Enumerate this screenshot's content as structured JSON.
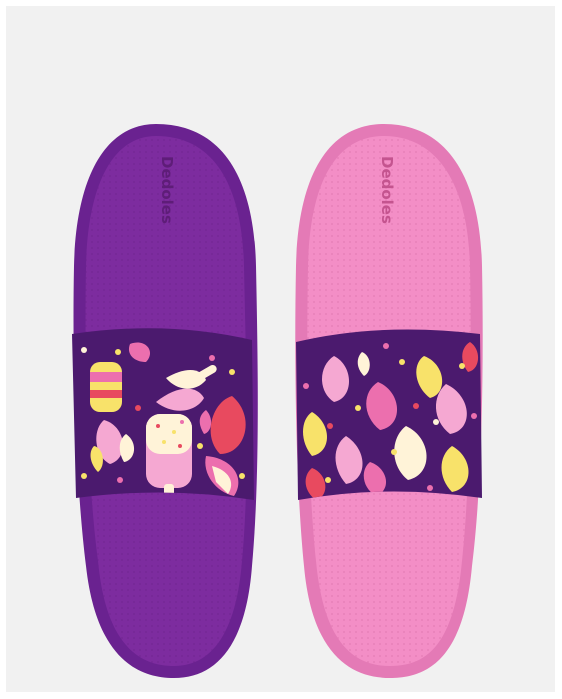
{
  "product": {
    "brand_logo_left": "Dedoles",
    "brand_logo_right": "Dedoles"
  },
  "colors": {
    "background": "#f1f1f1",
    "left_sole": "#7a2a9a",
    "left_sole_dark": "#5e1d78",
    "right_sole": "#f08ac4",
    "right_sole_dark": "#d96aa8",
    "strap": "#4b1a6e",
    "pink": "#ec6fae",
    "light_pink": "#f5a8d2",
    "yellow": "#f8e26a",
    "cream": "#fff3d8",
    "red": "#e84a5f"
  }
}
